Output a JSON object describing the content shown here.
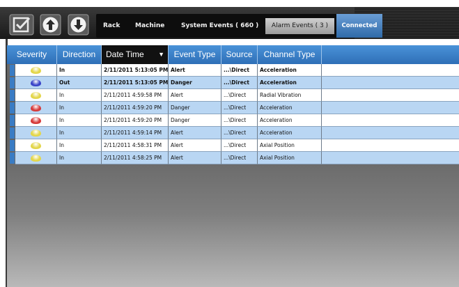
{
  "toolbar": {
    "buttons": [
      {
        "icon": "checkbox-icon",
        "kind": "checkbox"
      },
      {
        "icon": "arrow-up-icon",
        "kind": "up"
      },
      {
        "icon": "arrow-down-icon",
        "kind": "down"
      }
    ],
    "tabs": {
      "rack": "Rack",
      "machine": "Machine",
      "system_events": "System Events  ( 660 )",
      "alarm_events": "Alarm Events  ( 3 )",
      "connected": "Connected"
    }
  },
  "grid": {
    "headers": {
      "severity": "Severity",
      "direction": "Direction",
      "datetime": "Date Time",
      "event_type": "Event Type",
      "source": "Source",
      "channel_type": "Channel Type"
    },
    "sorted_column": "datetime",
    "colors": {
      "yellow": "#e3d64a",
      "blue": "#3a44c8",
      "red": "#d63a3a"
    },
    "rows": [
      {
        "severity": "yellow",
        "direction": "In",
        "datetime": "2/11/2011 5:13:05 PM",
        "event_type": "Alert",
        "source": "...\\Direct",
        "channel_type": "Acceleration",
        "bold": true
      },
      {
        "severity": "blue",
        "direction": "Out",
        "datetime": "2/11/2011 5:13:05 PM",
        "event_type": "Danger",
        "source": "...\\Direct",
        "channel_type": "Acceleration",
        "bold": true
      },
      {
        "severity": "yellow",
        "direction": "In",
        "datetime": "2/11/2011 4:59:58 PM",
        "event_type": "Alert",
        "source": "...\\Direct",
        "channel_type": "Radial Vibration",
        "bold": false
      },
      {
        "severity": "red",
        "direction": "In",
        "datetime": "2/11/2011 4:59:20 PM",
        "event_type": "Danger",
        "source": "...\\Direct",
        "channel_type": "Acceleration",
        "bold": false
      },
      {
        "severity": "red",
        "direction": "In",
        "datetime": "2/11/2011 4:59:20 PM",
        "event_type": "Danger",
        "source": "...\\Direct",
        "channel_type": "Acceleration",
        "bold": false
      },
      {
        "severity": "yellow",
        "direction": "In",
        "datetime": "2/11/2011 4:59:14 PM",
        "event_type": "Alert",
        "source": "...\\Direct",
        "channel_type": "Acceleration",
        "bold": false
      },
      {
        "severity": "yellow",
        "direction": "In",
        "datetime": "2/11/2011 4:58:31 PM",
        "event_type": "Alert",
        "source": "...\\Direct",
        "channel_type": "Axial Position",
        "bold": false
      },
      {
        "severity": "yellow",
        "direction": "In",
        "datetime": "2/11/2011 4:58:25 PM",
        "event_type": "Alert",
        "source": "...\\Direct",
        "channel_type": "Axial Position",
        "bold": false
      }
    ]
  }
}
